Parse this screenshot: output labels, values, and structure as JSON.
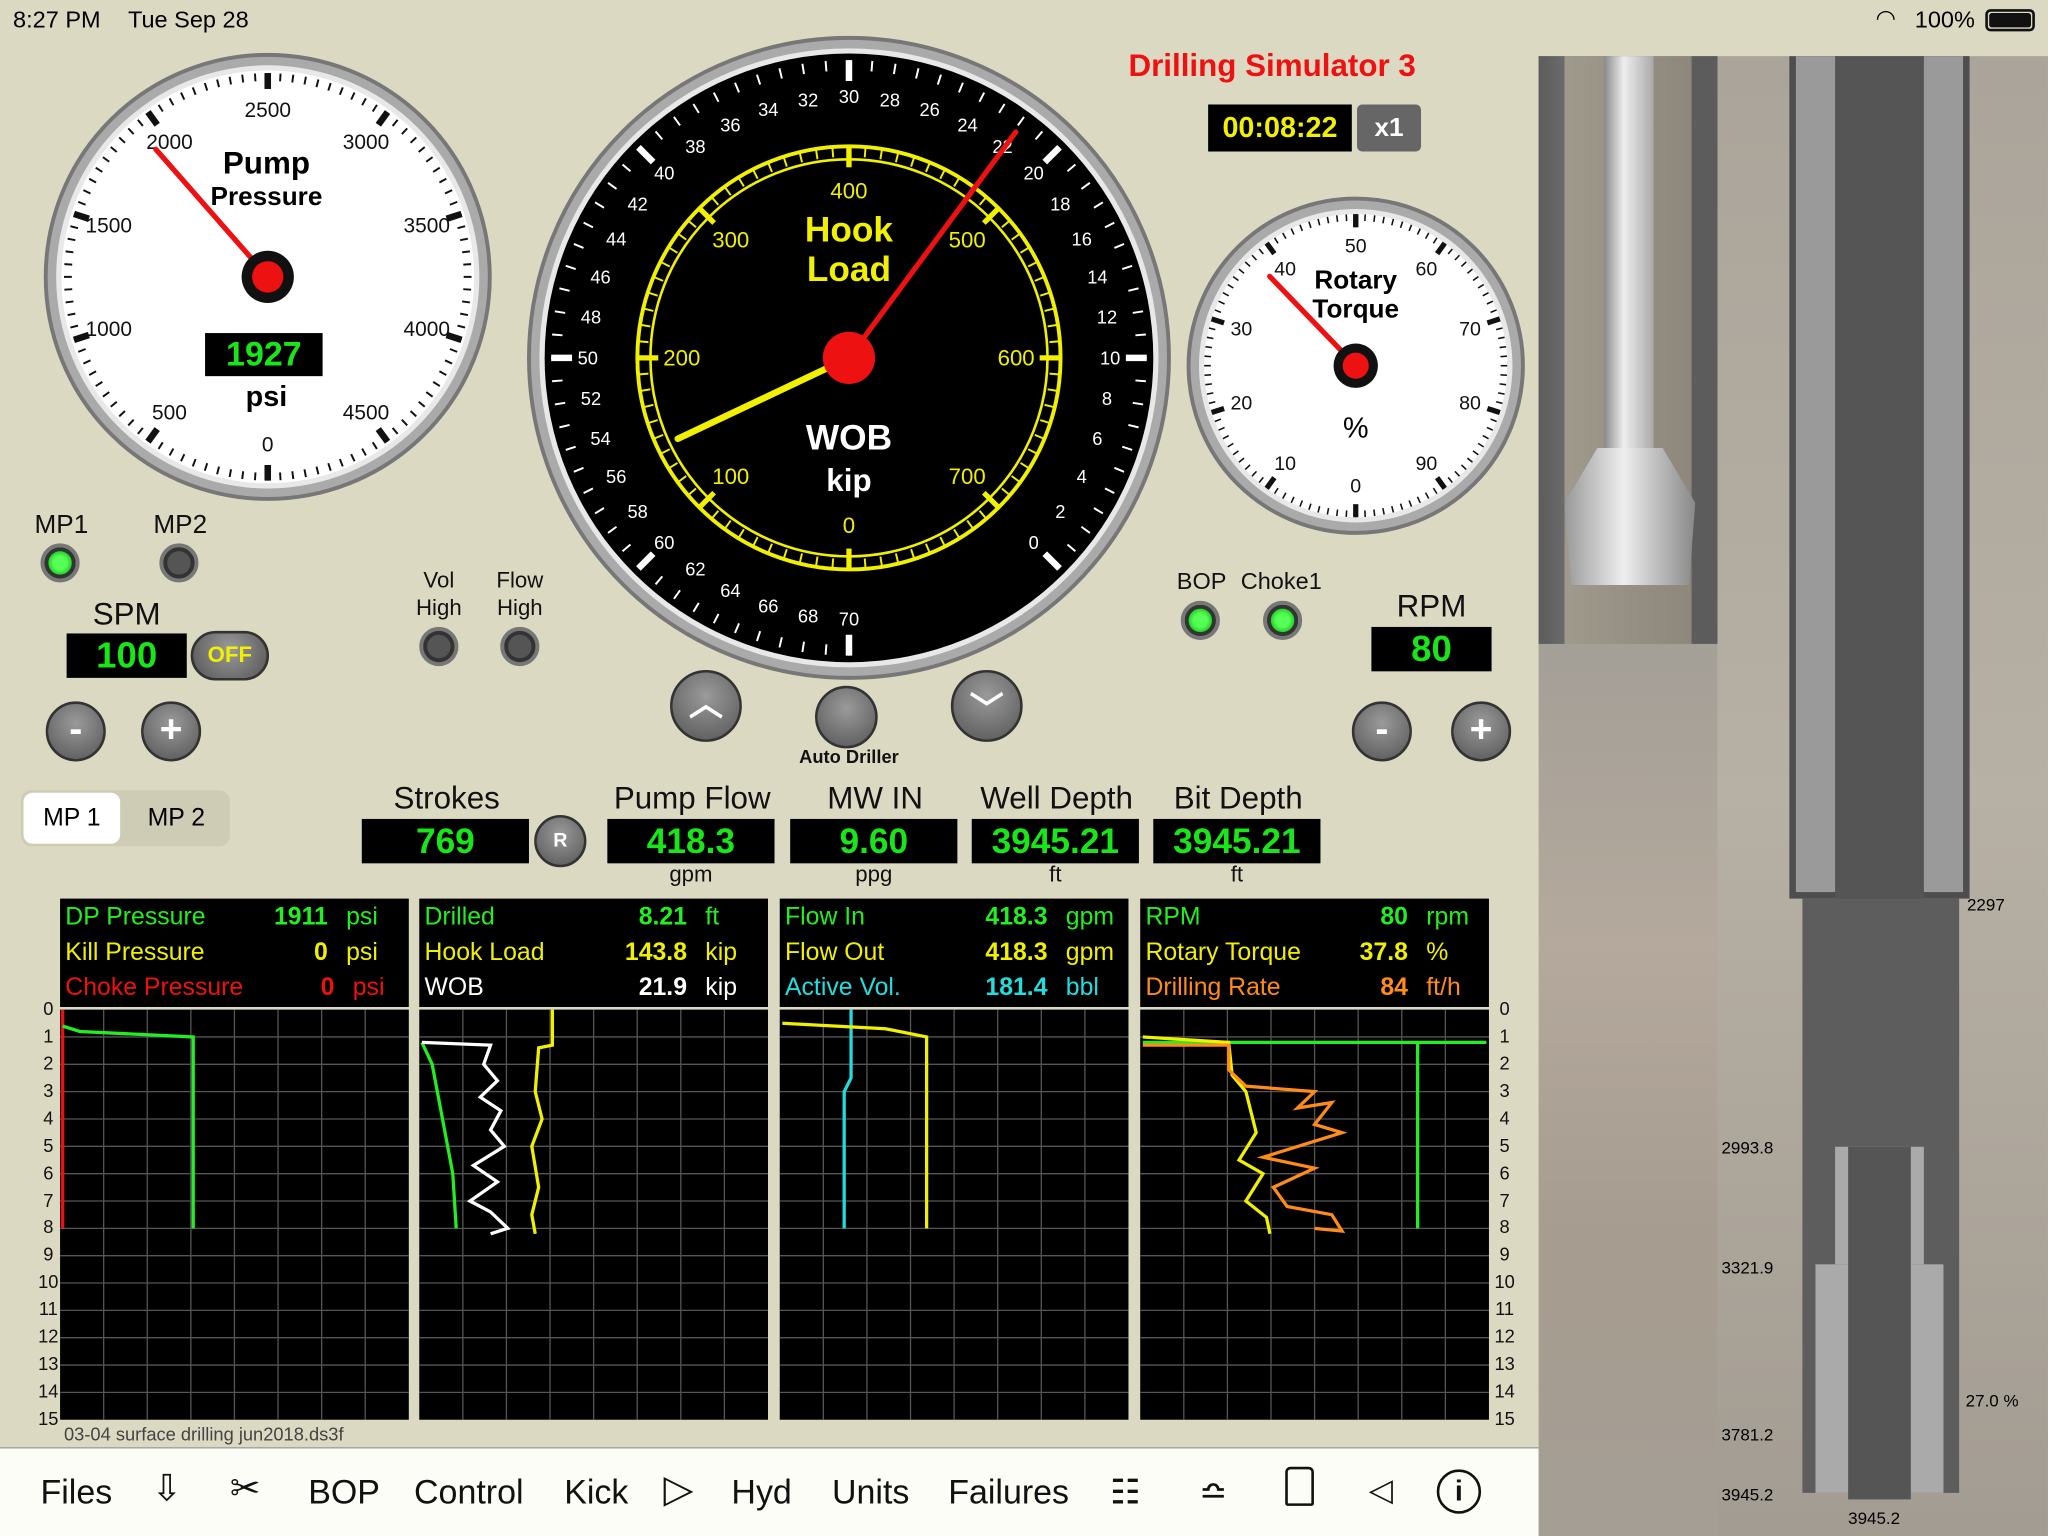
{
  "status_bar": {
    "time": "8:27 PM",
    "date": "Tue Sep 28",
    "battery": "100%"
  },
  "app": {
    "title": "Drilling Simulator 3",
    "timer": "00:08:22",
    "speed": "x1",
    "title_color": "#ee1111"
  },
  "pump_gauge": {
    "title1": "Pump",
    "title2": "Pressure",
    "value": 1927,
    "value_text": "1927",
    "unit": "psi",
    "ticks": [
      "0",
      "500",
      "1000",
      "1500",
      "2000",
      "2500",
      "3000",
      "3500",
      "4000",
      "4500"
    ],
    "min": 0,
    "max": 5000
  },
  "hook_gauge": {
    "title1": "Hook",
    "title2": "Load",
    "title3": "WOB",
    "title4": "kip",
    "inner_ticks": [
      "0",
      "100",
      "200",
      "300",
      "400",
      "500",
      "600",
      "700"
    ],
    "outer_ticks": [
      "0",
      "2",
      "4",
      "6",
      "8",
      "10",
      "12",
      "14",
      "16",
      "18",
      "20",
      "22",
      "24",
      "26",
      "28",
      "30",
      "32",
      "34",
      "36",
      "38",
      "40",
      "42",
      "44",
      "46",
      "48",
      "50",
      "52",
      "54",
      "56",
      "58",
      "60",
      "62",
      "64",
      "66",
      "68",
      "70"
    ],
    "hook_load": 143.8,
    "wob": 21.9
  },
  "torque_gauge": {
    "title1": "Rotary",
    "title2": "Torque",
    "unit": "%",
    "value": 37.8,
    "ticks": [
      "0",
      "10",
      "20",
      "30",
      "40",
      "50",
      "60",
      "70",
      "80",
      "90"
    ]
  },
  "pumps": {
    "mp1": "MP1",
    "mp2": "MP2",
    "mp1_on": true,
    "mp2_on": false,
    "spm_label": "SPM",
    "spm": "100",
    "off": "OFF",
    "minus": "-",
    "plus": "+"
  },
  "alarms": {
    "vol1": "Vol",
    "vol2": "High",
    "flow1": "Flow",
    "flow2": "High"
  },
  "driller": {
    "auto_driller": "Auto Driller"
  },
  "bop": {
    "bop": "BOP",
    "choke": "Choke1",
    "rpm_label": "RPM",
    "rpm": "80",
    "minus": "-",
    "plus": "+"
  },
  "mp_tabs": [
    "MP 1",
    "MP 2"
  ],
  "readouts": [
    {
      "label": "Strokes",
      "value": "769",
      "unit": "",
      "reset": "R"
    },
    {
      "label": "Pump Flow",
      "value": "418.3",
      "unit": "gpm"
    },
    {
      "label": "MW IN",
      "value": "9.60",
      "unit": "ppg"
    },
    {
      "label": "Well Depth",
      "value": "3945.21",
      "unit": "ft"
    },
    {
      "label": "Bit Depth",
      "value": "3945.21",
      "unit": "ft"
    }
  ],
  "panels": [
    {
      "rows": [
        {
          "name": "DP Pressure",
          "value": "1911",
          "unit": "psi",
          "color": "#22ee22"
        },
        {
          "name": "Kill Pressure",
          "value": "0",
          "unit": "psi",
          "color": "#f0f000"
        },
        {
          "name": "Choke Pressure",
          "value": "0",
          "unit": "psi",
          "color": "#ee1111"
        }
      ]
    },
    {
      "rows": [
        {
          "name": "Drilled",
          "value": "8.21",
          "unit": "ft",
          "color": "#22ee22"
        },
        {
          "name": "Hook Load",
          "value": "143.8",
          "unit": "kip",
          "color": "#f0f000"
        },
        {
          "name": "WOB",
          "value": "21.9",
          "unit": "kip",
          "color": "#ffffff"
        }
      ]
    },
    {
      "rows": [
        {
          "name": "Flow In",
          "value": "418.3",
          "unit": "gpm",
          "color": "#22ee22"
        },
        {
          "name": "Flow Out",
          "value": "418.3",
          "unit": "gpm",
          "color": "#f0f000"
        },
        {
          "name": "Active Vol.",
          "value": "181.4",
          "unit": "bbl",
          "color": "#22dddd"
        }
      ]
    },
    {
      "rows": [
        {
          "name": "RPM",
          "value": "80",
          "unit": "rpm",
          "color": "#22ee22"
        },
        {
          "name": "Rotary Torque",
          "value": "37.8",
          "unit": "%",
          "color": "#f0f000"
        },
        {
          "name": "Drilling Rate",
          "value": "84",
          "unit": "ft/h",
          "color": "#ff8c1a"
        }
      ]
    }
  ],
  "chart_data": {
    "type": "line",
    "y_ticks": [
      "0",
      "1",
      "2",
      "3",
      "4",
      "5",
      "6",
      "7",
      "8",
      "9",
      "10",
      "11",
      "12",
      "13",
      "14",
      "15"
    ],
    "ylim": [
      0,
      15
    ],
    "grid": true,
    "panels": [
      {
        "series": [
          {
            "color": "#ee1111",
            "points": [
              [
                0,
                0
              ],
              [
                0,
                8
              ]
            ]
          },
          {
            "color": "#22ee22",
            "points": [
              [
                0,
                0.6
              ],
              [
                0.05,
                0.8
              ],
              [
                0.38,
                1
              ],
              [
                0.38,
                8
              ]
            ]
          }
        ]
      },
      {
        "series": [
          {
            "color": "#22ee22",
            "points": [
              [
                0,
                1.2
              ],
              [
                0.03,
                2
              ],
              [
                0.06,
                4
              ],
              [
                0.09,
                6
              ],
              [
                0.1,
                8
              ]
            ]
          },
          {
            "color": "#ffffff",
            "points": [
              [
                0,
                1.2
              ],
              [
                0.2,
                1.3
              ],
              [
                0.18,
                2
              ],
              [
                0.22,
                2.6
              ],
              [
                0.17,
                3.2
              ],
              [
                0.23,
                3.7
              ],
              [
                0.2,
                4.4
              ],
              [
                0.24,
                5
              ],
              [
                0.15,
                5.7
              ],
              [
                0.22,
                6.3
              ],
              [
                0.14,
                7
              ],
              [
                0.2,
                7.4
              ],
              [
                0.25,
                8
              ],
              [
                0.2,
                8.2
              ]
            ]
          },
          {
            "color": "#f0f000",
            "points": [
              [
                0.38,
                0
              ],
              [
                0.38,
                1.3
              ],
              [
                0.34,
                1.4
              ],
              [
                0.33,
                3
              ],
              [
                0.35,
                4
              ],
              [
                0.32,
                5
              ],
              [
                0.34,
                6.5
              ],
              [
                0.32,
                7.5
              ],
              [
                0.33,
                8.2
              ]
            ]
          }
        ]
      },
      {
        "series": [
          {
            "color": "#22dddd",
            "points": [
              [
                0.2,
                0
              ],
              [
                0.2,
                2.5
              ],
              [
                0.18,
                3
              ],
              [
                0.18,
                8
              ]
            ]
          },
          {
            "color": "#f0f000",
            "points": [
              [
                0,
                0.5
              ],
              [
                0.3,
                0.7
              ],
              [
                0.42,
                1
              ],
              [
                0.42,
                8
              ]
            ]
          }
        ]
      },
      {
        "series": [
          {
            "color": "#22ee22",
            "points": [
              [
                0,
                1.2
              ],
              [
                1,
                1.2
              ]
            ]
          },
          {
            "color": "#22ee22",
            "points": [
              [
                0.8,
                1.2
              ],
              [
                0.8,
                8
              ]
            ]
          },
          {
            "color": "#f0f000",
            "points": [
              [
                0,
                1
              ],
              [
                0.25,
                1.2
              ],
              [
                0.26,
                2.4
              ],
              [
                0.3,
                3
              ],
              [
                0.33,
                4.5
              ],
              [
                0.28,
                5.5
              ],
              [
                0.35,
                6
              ],
              [
                0.3,
                7
              ],
              [
                0.36,
                7.6
              ],
              [
                0.37,
                8.2
              ]
            ]
          },
          {
            "color": "#ff8c1a",
            "points": [
              [
                0,
                1.3
              ],
              [
                0.25,
                1.3
              ],
              [
                0.25,
                2.2
              ],
              [
                0.3,
                2.8
              ],
              [
                0.5,
                3
              ],
              [
                0.45,
                3.6
              ],
              [
                0.55,
                3.4
              ],
              [
                0.5,
                4.2
              ],
              [
                0.58,
                4.5
              ],
              [
                0.35,
                5.4
              ],
              [
                0.5,
                5.8
              ],
              [
                0.38,
                6.5
              ],
              [
                0.42,
                7.2
              ],
              [
                0.55,
                7.5
              ],
              [
                0.58,
                8.1
              ],
              [
                0.5,
                8
              ]
            ]
          }
        ]
      }
    ]
  },
  "filename": "03-04 surface drilling jun2018.ds3f",
  "nav": [
    "Files",
    "BOP",
    "Control",
    "Kick",
    "Hyd",
    "Units",
    "Failures"
  ],
  "wellbore": {
    "labels": [
      "2297",
      "2993.8",
      "3321.9",
      "3781.2",
      "3945.2",
      "27.0 %",
      "3945.2"
    ]
  }
}
